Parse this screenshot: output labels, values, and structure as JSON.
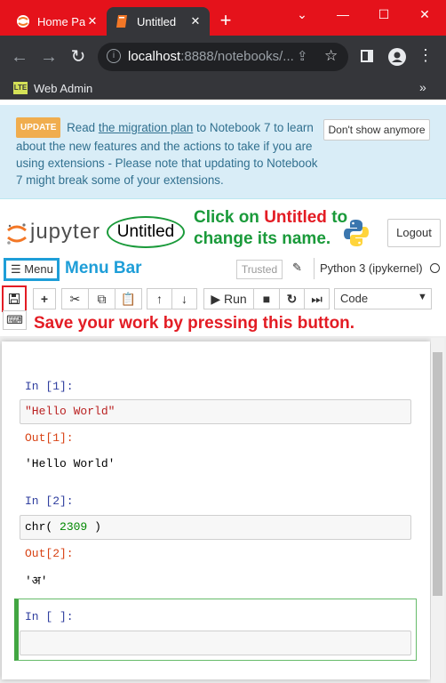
{
  "browser": {
    "tabs": [
      {
        "title": "Home Pa",
        "icon": "jupyter-favicon"
      },
      {
        "title": "Untitled",
        "icon": "notebook-favicon"
      }
    ],
    "url_host": "localhost",
    "url_rest": ":8888/notebooks/...",
    "bookmark": "Web Admin",
    "bookmark_icon": "LTE"
  },
  "banner": {
    "badge": "UPDATE",
    "text_pre": "Read",
    "link": "the migration plan",
    "text_post": "to Notebook 7 to learn about the new features and the actions to take if you are using extensions - Please note that updating to Notebook 7 might break some of your extensions.",
    "dismiss": "Don't show anymore"
  },
  "header": {
    "jupyter_word": "jupyter",
    "notebook_name": "Untitled",
    "logout": "Logout"
  },
  "annotations": {
    "rename_pre": "Click on",
    "rename_red": "Untitled",
    "rename_post": "to change its name.",
    "menubar": "Menu Bar",
    "save": "Save your work by pressing this button."
  },
  "menubar": {
    "menu_label": "Menu",
    "trusted": "Trusted",
    "kernel": "Python 3 (ipykernel)"
  },
  "toolbar": {
    "run": "Run",
    "cell_type": "Code"
  },
  "cells": [
    {
      "in_prompt": "In [1]:",
      "code": "\"Hello World\"",
      "out_prompt": "Out[1]:",
      "output": "'Hello World'"
    },
    {
      "in_prompt": "In [2]:",
      "code_fn": "chr(",
      "code_num": "2309",
      "code_end": ")",
      "out_prompt": "Out[2]:",
      "output": "'अ'"
    },
    {
      "in_prompt": "In [ ]:"
    }
  ],
  "colors": {
    "chrome_red": "#e5121b",
    "annotation_green": "#1a9a3a",
    "annotation_red": "#e31c24",
    "annotation_blue": "#1e9ed8"
  }
}
